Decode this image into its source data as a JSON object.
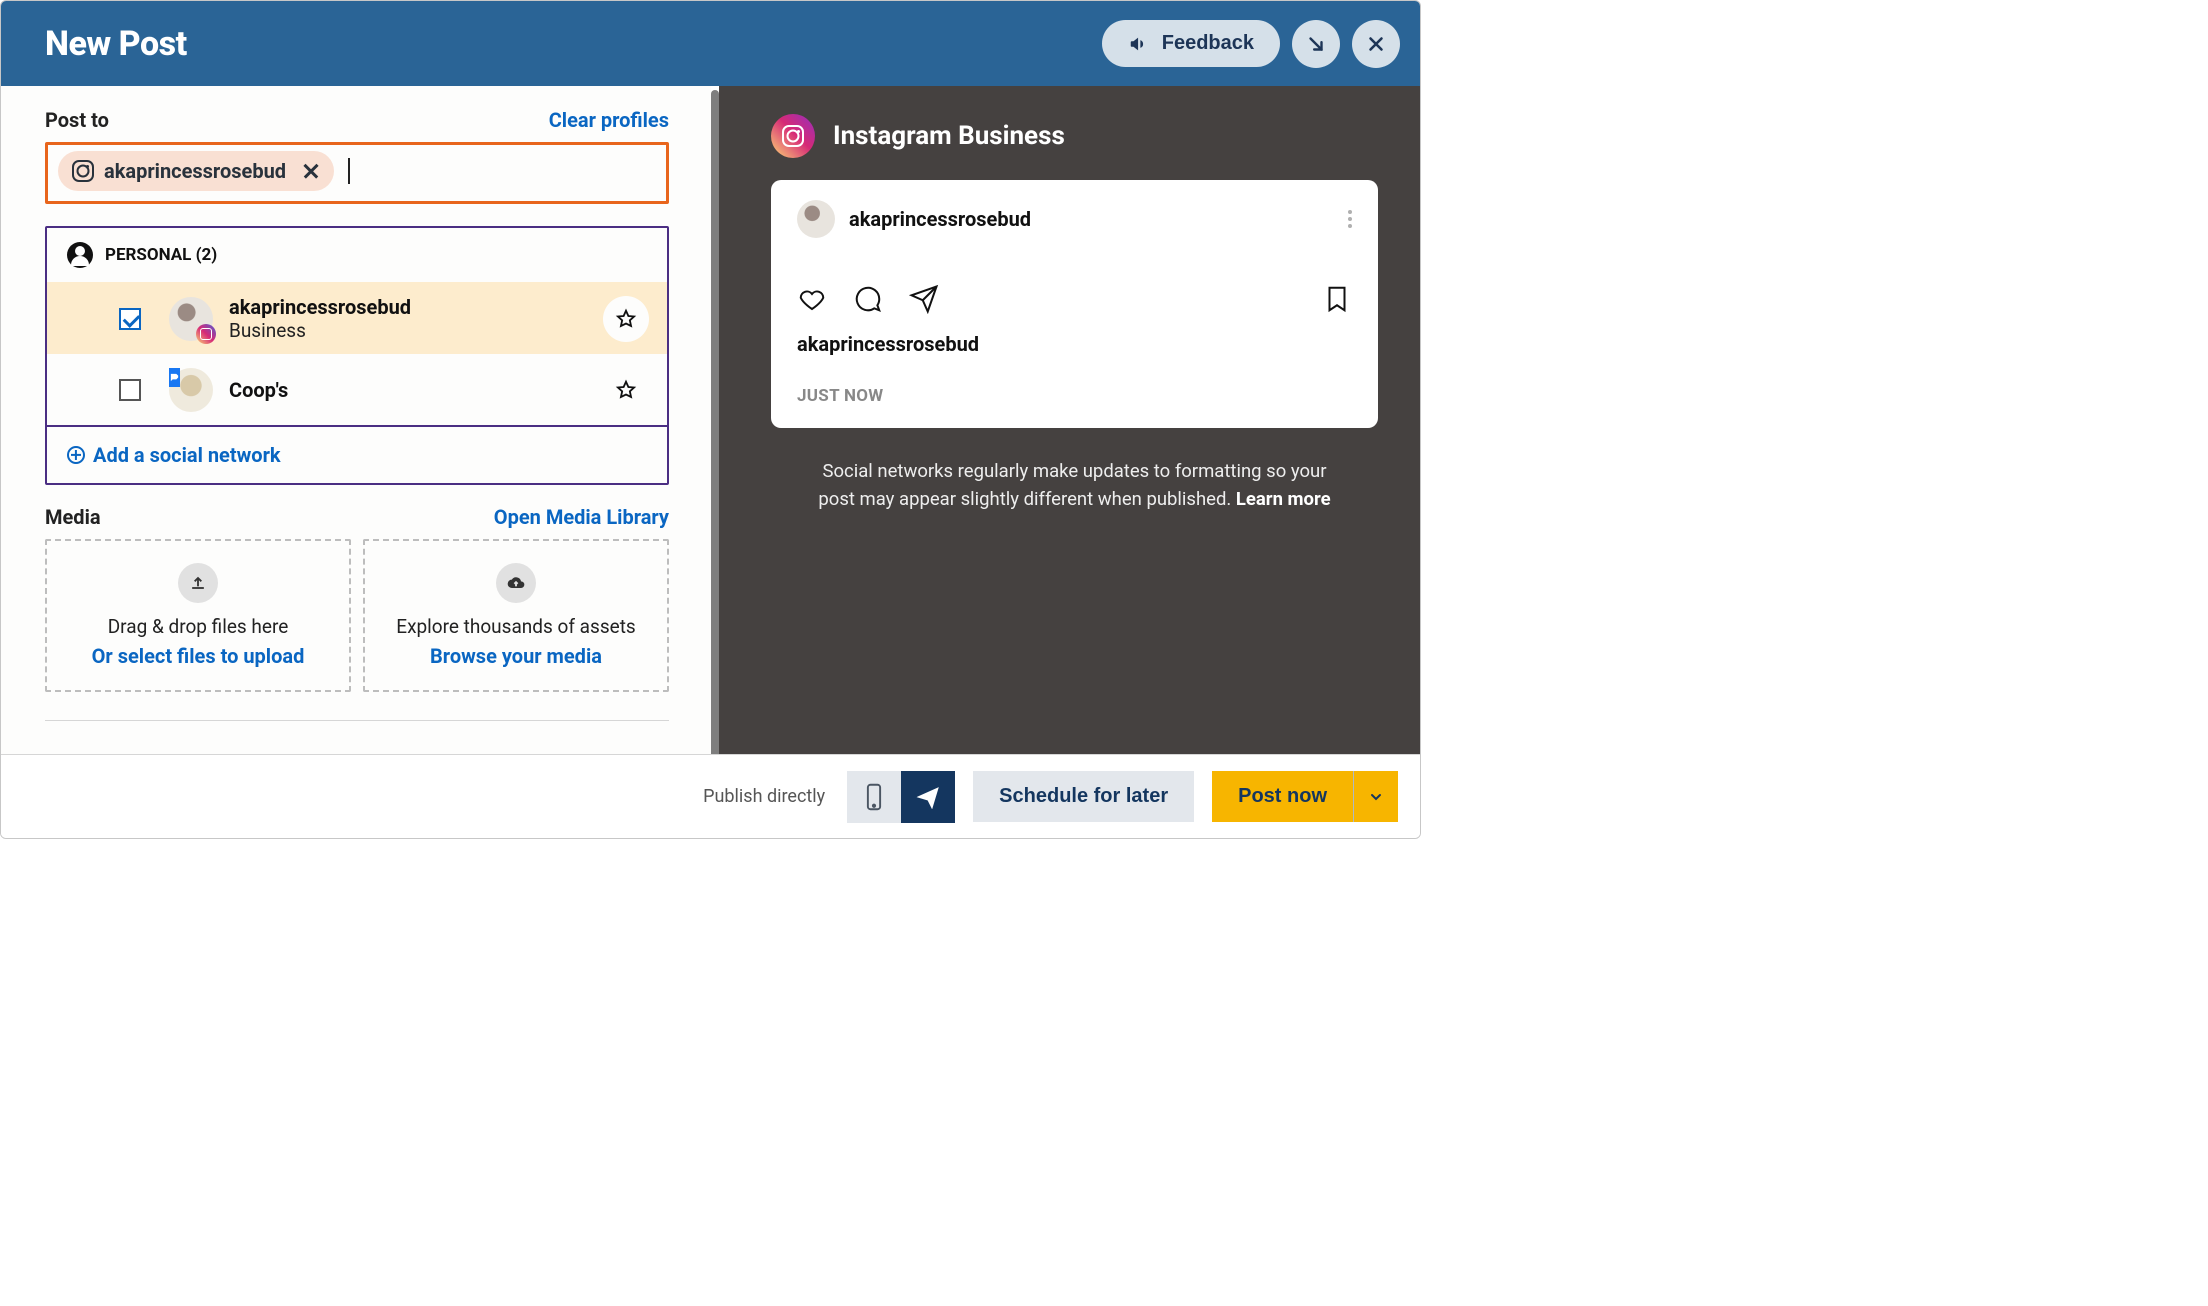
{
  "header": {
    "title": "New Post",
    "feedback_label": "Feedback"
  },
  "post_to": {
    "label": "Post to",
    "clear_profiles": "Clear profiles",
    "selected_chip": {
      "handle": "akaprincessrosebud"
    }
  },
  "account_group": {
    "label": "PERSONAL (2)",
    "accounts": [
      {
        "name": "akaprincessrosebud",
        "subtitle": "Business",
        "network": "instagram",
        "checked": true
      },
      {
        "name": "Coop's",
        "subtitle": "",
        "network": "facebook",
        "checked": false
      }
    ],
    "add_network_label": "Add a social network"
  },
  "media": {
    "label": "Media",
    "open_library": "Open Media Library",
    "dropzone1": {
      "line1": "Drag & drop files here",
      "line2": "Or select files to upload"
    },
    "dropzone2": {
      "line1": "Explore thousands of assets",
      "line2": "Browse your media"
    }
  },
  "preview": {
    "title": "Instagram Business",
    "card": {
      "username": "akaprincessrosebud",
      "caption_user": "akaprincessrosebud",
      "timestamp": "JUST NOW"
    },
    "disclaimer": "Social networks regularly make updates to formatting so your post may appear slightly different when published. ",
    "learn_more": "Learn more"
  },
  "footer": {
    "publish_directly": "Publish directly",
    "schedule_label": "Schedule for later",
    "post_now_label": "Post now"
  }
}
